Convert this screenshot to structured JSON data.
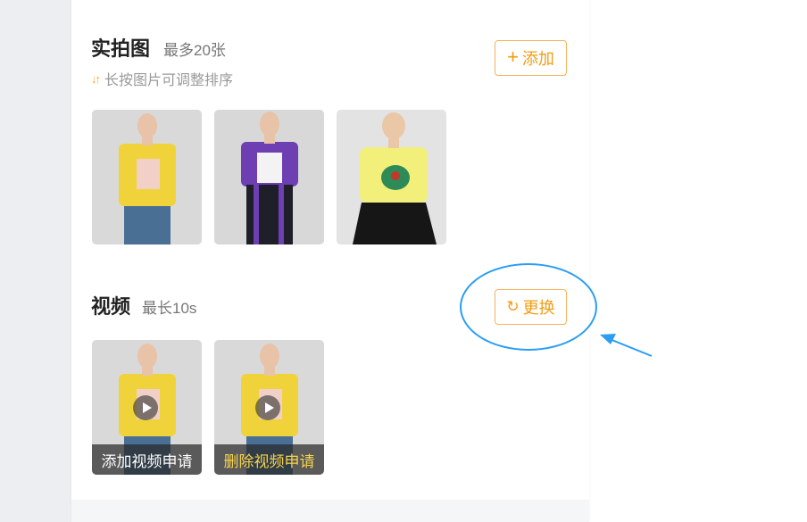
{
  "photos": {
    "title": "实拍图",
    "limit": "最多20张",
    "sort_hint": "长按图片可调整排序",
    "add_button": "添加",
    "items": [
      {
        "alt": "yellow-tee-jeans-photo"
      },
      {
        "alt": "purple-tee-stripe-pants-photo"
      },
      {
        "alt": "yellow-offshoulder-top-photo"
      }
    ]
  },
  "video": {
    "title": "视频",
    "limit": "最长10s",
    "replace_button": "更换",
    "items": [
      {
        "caption": "添加视频申请"
      },
      {
        "caption": "删除视频申请"
      }
    ]
  },
  "colors": {
    "accent": "#f39c12",
    "annotation": "#2a9df4"
  },
  "icons": [
    "sort-icon",
    "plus-icon",
    "refresh-icon",
    "play-icon"
  ]
}
